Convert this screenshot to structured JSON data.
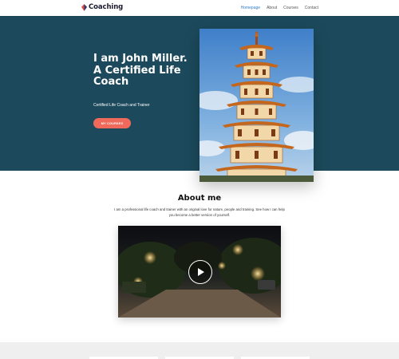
{
  "header": {
    "logo_text": "Coaching",
    "nav": [
      {
        "label": "Homepage"
      },
      {
        "label": "About"
      },
      {
        "label": "Courses"
      },
      {
        "label": "Contact"
      }
    ]
  },
  "hero": {
    "title": "I am John Miller. A Certified Life Coach",
    "subtitle": "Certified Life Coach and Trainer",
    "button_label": "MY COURSES"
  },
  "about": {
    "title": "About me",
    "text": "I am a professional life coach and trainer with an original love for nature, people and training. See how I can help you become a better version of yourself."
  },
  "colors": {
    "hero_bg": "#1c4a5c",
    "accent": "#ef6a5a",
    "nav_active": "#2e7ec9"
  }
}
